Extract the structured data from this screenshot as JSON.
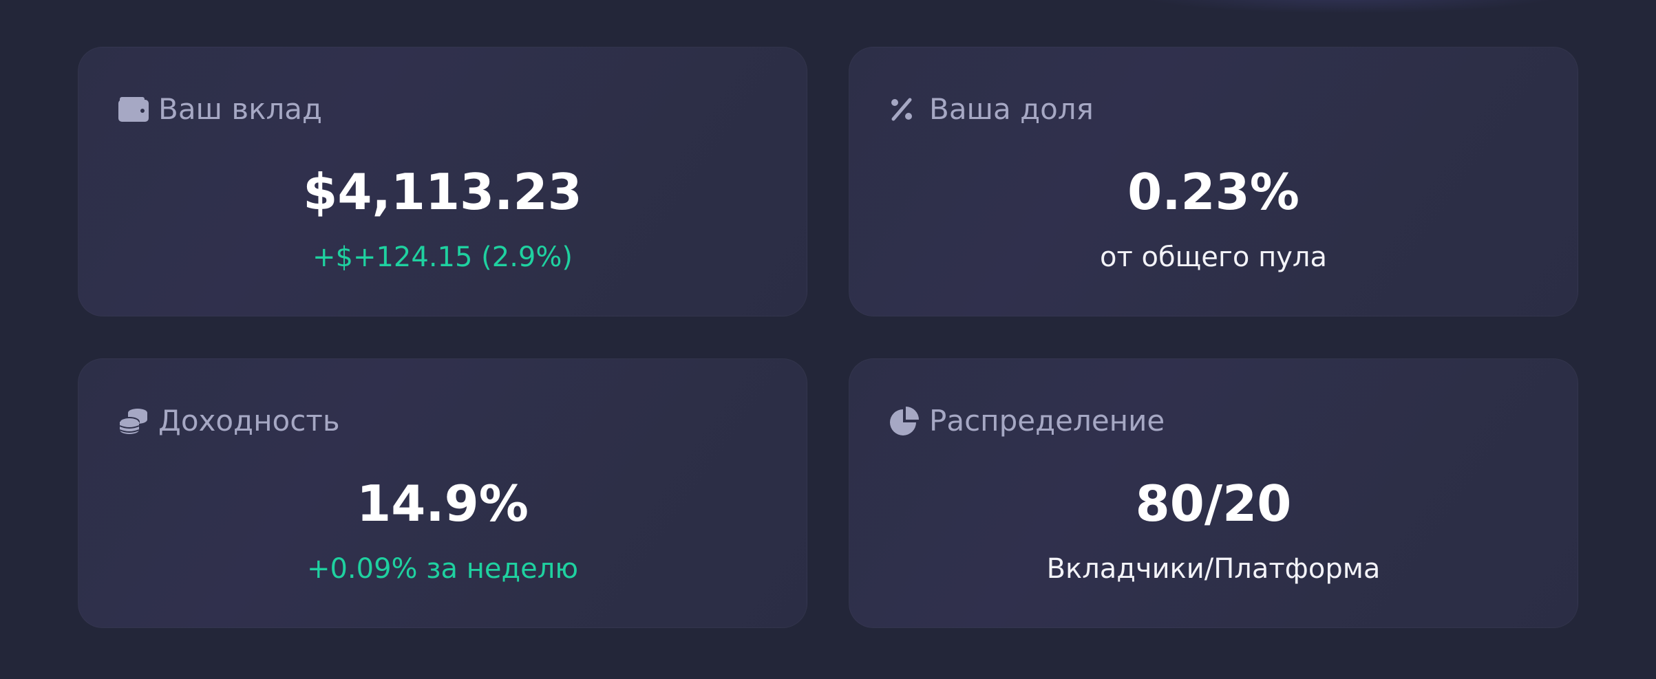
{
  "cards": [
    {
      "icon": "wallet-icon",
      "label": "Ваш вклад",
      "value": "$4,113.23",
      "sub": "+$+124.15 (2.9%)",
      "sub_color": "#1fd1a0"
    },
    {
      "icon": "percent-icon",
      "label": "Ваша доля",
      "value": "0.23%",
      "sub": "от общего пула",
      "sub_color": "#f3f3f8"
    },
    {
      "icon": "coins-icon",
      "label": "Доходность",
      "value": "14.9%",
      "sub": "+0.09% за неделю",
      "sub_color": "#1fd1a0"
    },
    {
      "icon": "pie-chart-icon",
      "label": "Распределение",
      "value": "80/20",
      "sub": "Вкладчики/Платформа",
      "sub_color": "#f3f3f8"
    }
  ],
  "colors": {
    "background": "#232639",
    "card": "#2e304a",
    "label": "#a6a8c4",
    "positive": "#1fd1a0",
    "value": "#ffffff"
  }
}
